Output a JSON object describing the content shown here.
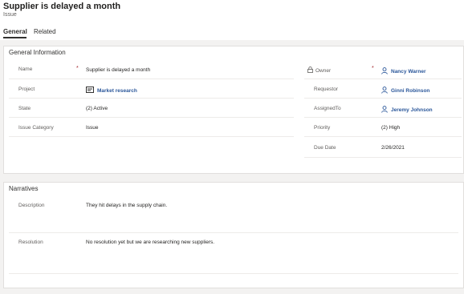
{
  "header": {
    "title": "Supplier is delayed a month",
    "entity_type": "Issue"
  },
  "tabs": [
    {
      "label": "General"
    },
    {
      "label": "Related"
    }
  ],
  "general": {
    "section_title": "General Information",
    "name_label": "Name",
    "name_value": "Supplier is delayed a month",
    "project_label": "Project",
    "project_value": "Market research",
    "state_label": "State",
    "state_value": "(2) Active",
    "category_label": "Issue Category",
    "category_value": "Issue",
    "owner_label": "Owner",
    "owner_value": "Nancy Warner",
    "requestor_label": "Requestor",
    "requestor_value": "Ginni Robinson",
    "assigned_label": "AssignedTo",
    "assigned_value": "Jeremy Johnson",
    "priority_label": "Priority",
    "priority_value": "(2) High",
    "duedate_label": "Due Date",
    "duedate_value": "2/26/2021",
    "required_marker": "*"
  },
  "narratives": {
    "section_title": "Narratives",
    "description_label": "Description",
    "description_value": "They hit delays in the supply chain.",
    "resolution_label": "Resolution",
    "resolution_value": "No resolution yet but we are researching new suppliers."
  },
  "icons": {
    "lock": "lock-icon",
    "person": "person-icon",
    "project": "project-icon"
  }
}
